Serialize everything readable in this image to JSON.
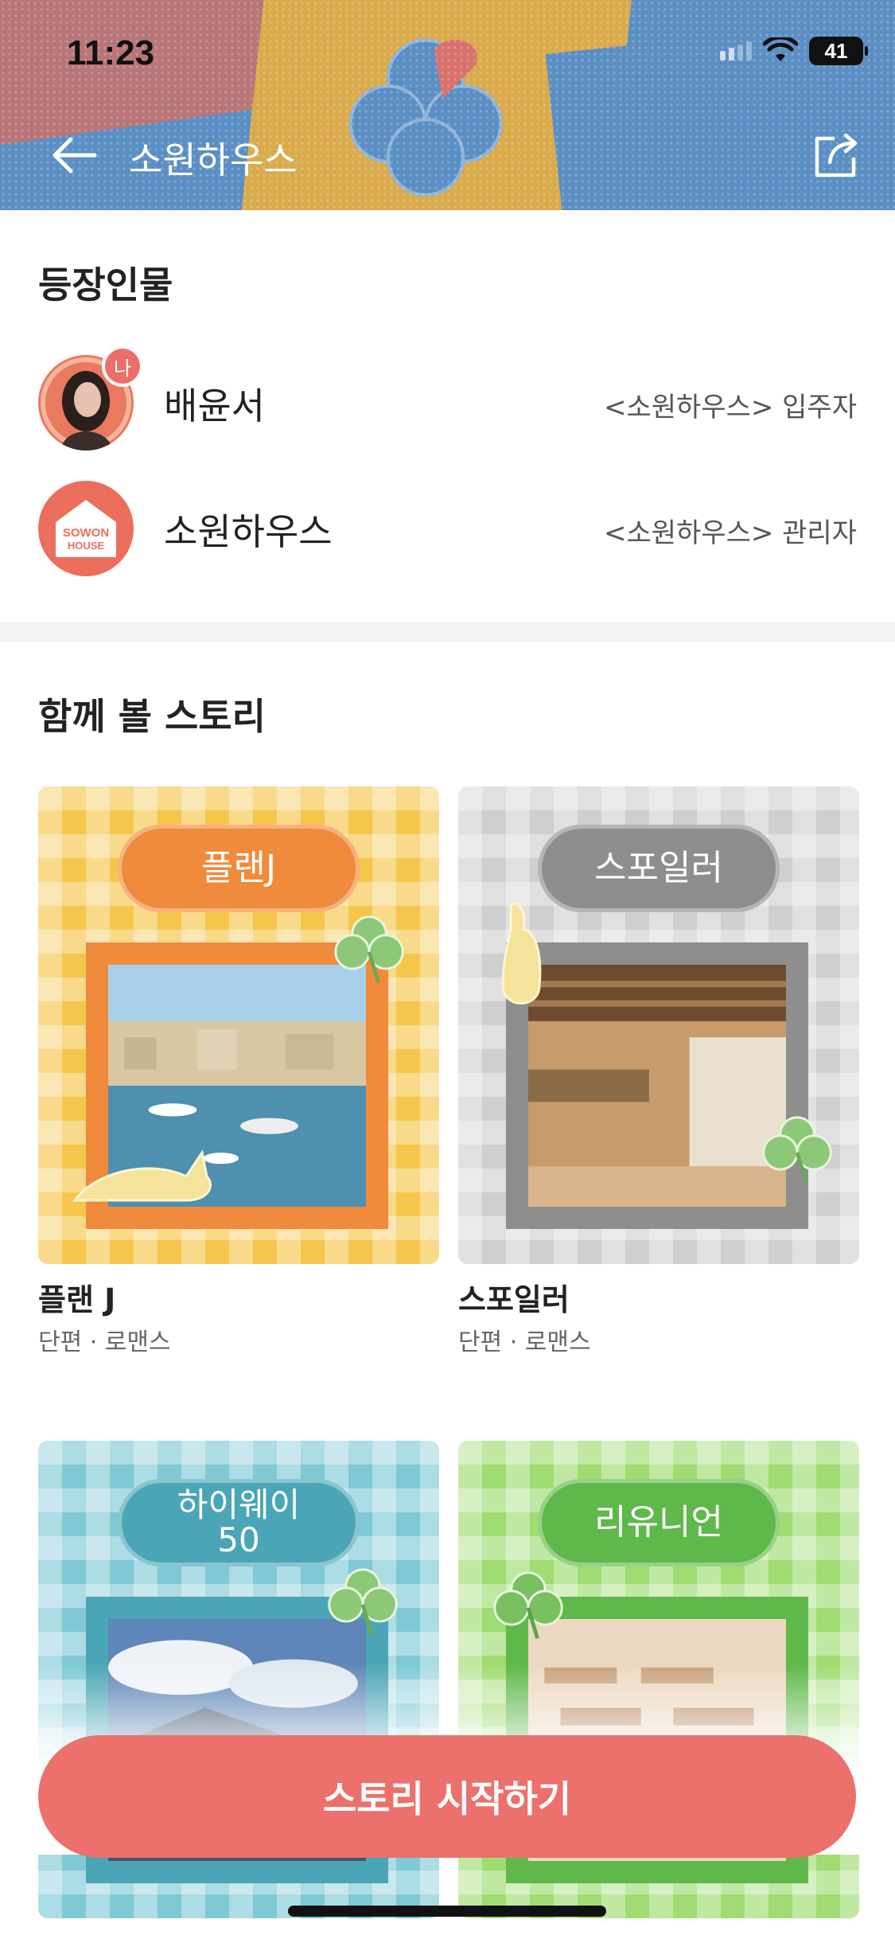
{
  "status_bar": {
    "time": "11:23",
    "battery": "41"
  },
  "header": {
    "title": "소원하우스"
  },
  "characters": {
    "title": "등장인물",
    "items": [
      {
        "name": "배윤서",
        "role": "<소원하우스> 입주자",
        "badge": "나"
      },
      {
        "name": "소원하우스",
        "role": "<소원하우스> 관리자",
        "logo_line1": "SOWON",
        "logo_line2": "HOUSE"
      }
    ]
  },
  "stories": {
    "title": "함께 볼 스토리",
    "items": [
      {
        "cover_label": "플랜J",
        "title": "플랜 J",
        "meta": "단편 · 로맨스",
        "theme": "#f5c64b",
        "accent": "#f08a3c"
      },
      {
        "cover_label": "스포일러",
        "title": "스포일러",
        "meta": "단편 · 로맨스",
        "theme": "#cfcfcf",
        "accent": "#8e8e8e"
      },
      {
        "cover_label": "하이웨이\n50",
        "theme": "#7fc9d6",
        "accent": "#4aa6b6"
      },
      {
        "cover_label": "리유니언",
        "theme": "#9fdc72",
        "accent": "#5fb84a"
      }
    ]
  },
  "cta": {
    "label": "스토리 시작하기"
  },
  "colors": {
    "brand": "#ec706b",
    "header_bg": "#5b8fc4"
  }
}
